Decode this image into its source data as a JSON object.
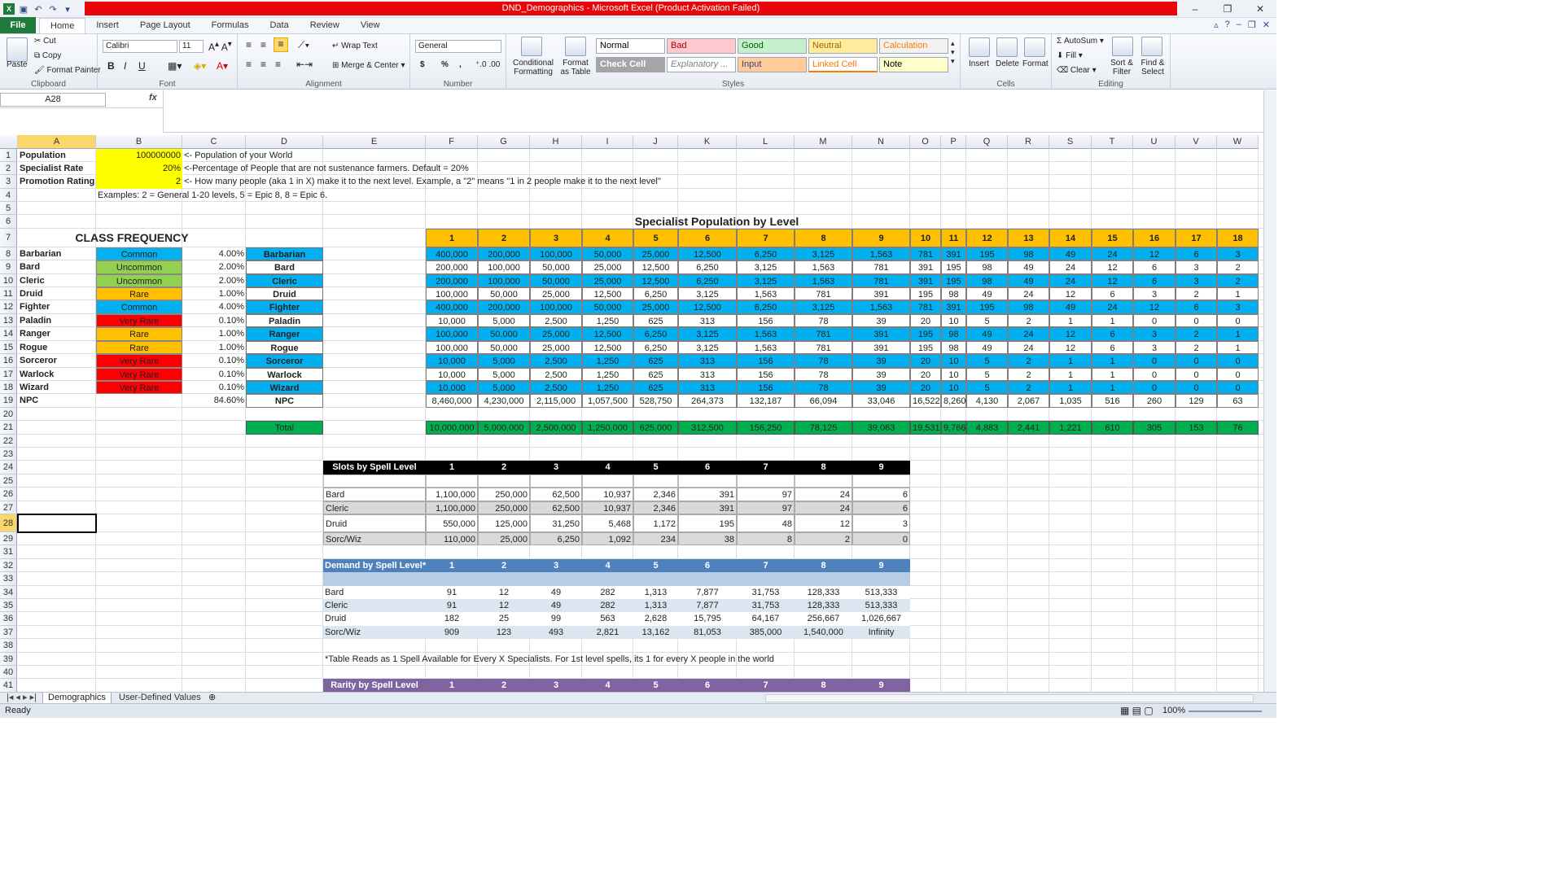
{
  "window": {
    "title": "DND_Demographics - Microsoft Excel (Product Activation Failed)",
    "min": "–",
    "restore": "❐",
    "close": "✕"
  },
  "menu": {
    "file": "File",
    "tabs": [
      "Home",
      "Insert",
      "Page Layout",
      "Formulas",
      "Data",
      "Review",
      "View"
    ]
  },
  "ribbon": {
    "clipboard": {
      "paste": "Paste",
      "cut": "Cut",
      "copy": "Copy",
      "painter": "Format Painter",
      "label": "Clipboard"
    },
    "font": {
      "name": "Calibri",
      "size": "11",
      "label": "Font",
      "bold": "B",
      "italic": "I",
      "underline": "U"
    },
    "alignment": {
      "wrap": "Wrap Text",
      "merge": "Merge & Center",
      "label": "Alignment"
    },
    "number": {
      "format": "General",
      "dollar": "$",
      "percent": "%",
      "comma": ",",
      "label": "Number"
    },
    "styles": {
      "cond": [
        "Conditional",
        "Formatting"
      ],
      "table": [
        "Format",
        "as Table"
      ],
      "label": "Styles",
      "boxes": [
        {
          "t": "Normal",
          "bg": "#ffffff",
          "fg": "#000000"
        },
        {
          "t": "Bad",
          "bg": "#ffc7ce",
          "fg": "#9c0006"
        },
        {
          "t": "Good",
          "bg": "#c6efce",
          "fg": "#006100"
        },
        {
          "t": "Neutral",
          "bg": "#ffeb9c",
          "fg": "#9c6500"
        },
        {
          "t": "Calculation",
          "bg": "#f2f2f2",
          "fg": "#fa7d00"
        },
        {
          "t": "Check Cell",
          "bg": "#a5a5a5",
          "fg": "#ffffff"
        },
        {
          "t": "Explanatory ...",
          "bg": "#ffffff",
          "fg": "#7f7f7f"
        },
        {
          "t": "Input",
          "bg": "#ffcc99",
          "fg": "#3f3f76"
        },
        {
          "t": "Linked Cell",
          "bg": "#ffffff",
          "fg": "#fa7d00"
        },
        {
          "t": "Note",
          "bg": "#ffffcc",
          "fg": "#000000"
        }
      ]
    },
    "cells": {
      "insert": "Insert",
      "delete": "Delete",
      "format": "Format",
      "label": "Cells"
    },
    "editing": {
      "autosum": "AutoSum",
      "fill": "Fill",
      "clear": "Clear",
      "sort": [
        "Sort &",
        "Filter"
      ],
      "find": [
        "Find &",
        "Select"
      ],
      "label": "Editing"
    }
  },
  "formula_bar": {
    "name_box": "A28",
    "fx": "fx",
    "content": ""
  },
  "columns": [
    {
      "l": "A",
      "w": 96
    },
    {
      "l": "B",
      "w": 106
    },
    {
      "l": "C",
      "w": 78
    },
    {
      "l": "D",
      "w": 95
    },
    {
      "l": "E",
      "w": 126
    },
    {
      "l": "F",
      "w": 64
    },
    {
      "l": "G",
      "w": 64
    },
    {
      "l": "H",
      "w": 64
    },
    {
      "l": "I",
      "w": 63
    },
    {
      "l": "J",
      "w": 55
    },
    {
      "l": "K",
      "w": 72
    },
    {
      "l": "L",
      "w": 71
    },
    {
      "l": "M",
      "w": 71
    },
    {
      "l": "N",
      "w": 71
    },
    {
      "l": "O",
      "w": 38
    },
    {
      "l": "P",
      "w": 31
    },
    {
      "l": "Q",
      "w": 51
    },
    {
      "l": "R",
      "w": 51
    },
    {
      "l": "S",
      "w": 52
    },
    {
      "l": "T",
      "w": 51
    },
    {
      "l": "U",
      "w": 52
    },
    {
      "l": "V",
      "w": 51
    },
    {
      "l": "W",
      "w": 51
    }
  ],
  "rows": [
    {
      "n": "1",
      "h": 16
    },
    {
      "n": "2",
      "h": 16
    },
    {
      "n": "3",
      "h": 17
    },
    {
      "n": "4",
      "h": 16
    },
    {
      "n": "5",
      "h": 16
    },
    {
      "n": "6",
      "h": 17
    },
    {
      "n": "7",
      "h": 23
    },
    {
      "n": "8",
      "h": 16
    },
    {
      "n": "9",
      "h": 17
    },
    {
      "n": "10",
      "h": 16
    },
    {
      "n": "11",
      "h": 16
    },
    {
      "n": "12",
      "h": 17
    },
    {
      "n": "13",
      "h": 16
    },
    {
      "n": "14",
      "h": 17
    },
    {
      "n": "15",
      "h": 16
    },
    {
      "n": "16",
      "h": 17
    },
    {
      "n": "17",
      "h": 16
    },
    {
      "n": "18",
      "h": 16
    },
    {
      "n": "19",
      "h": 17
    },
    {
      "n": "20",
      "h": 16
    },
    {
      "n": "21",
      "h": 17
    },
    {
      "n": "22",
      "h": 16
    },
    {
      "n": "23",
      "h": 16
    },
    {
      "n": "24",
      "h": 17
    },
    {
      "n": "25",
      "h": 16
    },
    {
      "n": "26",
      "h": 17
    },
    {
      "n": "27",
      "h": 16
    },
    {
      "n": "28",
      "h": 22
    },
    {
      "n": "29",
      "h": 16
    },
    {
      "n": "31",
      "h": 17
    },
    {
      "n": "32",
      "h": 16
    },
    {
      "n": "33",
      "h": 17
    },
    {
      "n": "34",
      "h": 16
    },
    {
      "n": "35",
      "h": 16
    },
    {
      "n": "36",
      "h": 17
    },
    {
      "n": "37",
      "h": 16
    },
    {
      "n": "38",
      "h": 17
    },
    {
      "n": "39",
      "h": 16
    },
    {
      "n": "40",
      "h": 16
    },
    {
      "n": "41",
      "h": 17
    }
  ],
  "top_cells": [
    {
      "r": "1",
      "c": "A",
      "t": "Population",
      "b": 1
    },
    {
      "r": "1",
      "c": "B",
      "t": "100000000",
      "bg": "#ffff00",
      "al": "r"
    },
    {
      "r": "1",
      "c": "C",
      "t": "<- Population of your World",
      "sp": 5
    },
    {
      "r": "2",
      "c": "A",
      "t": "Specialist Rate",
      "b": 1
    },
    {
      "r": "2",
      "c": "B",
      "t": "20%",
      "bg": "#ffff00",
      "al": "r"
    },
    {
      "r": "2",
      "c": "C",
      "t": "<-Percentage of People that are not sustenance farmers. Default = 20%",
      "sp": 6
    },
    {
      "r": "3",
      "c": "A",
      "t": "Promotion Rating",
      "b": 1
    },
    {
      "r": "3",
      "c": "B",
      "t": "2",
      "bg": "#ffff00",
      "al": "r"
    },
    {
      "r": "3",
      "c": "C",
      "t": "<- How many people (aka 1 in X) make it to the next level. Example, a \"2\" means \"1 in 2 people make it to the next level\"",
      "sp": 12
    },
    {
      "r": "4",
      "c": "B",
      "t": "Examples: 2 = General 1-20 levels, 5 = Epic 8, 8 = Epic 6.",
      "sp": 6
    },
    {
      "r": "6",
      "c": "F",
      "t": "Specialist Population by Level",
      "b": 1,
      "sp": 12,
      "al": "c",
      "fs": 14
    },
    {
      "r": "7",
      "c": "A",
      "t": "CLASS FREQUENCY",
      "b": 1,
      "sp": 3,
      "al": "c",
      "fs": 14
    }
  ],
  "class_rows": [
    {
      "r": "8",
      "name": "Barbarian",
      "rarity": "Common",
      "rbg": "#00b0f0",
      "pct": "4.00%",
      "dbg": "#00b0f0"
    },
    {
      "r": "9",
      "name": "Bard",
      "rarity": "Uncommon",
      "rbg": "#92d050",
      "pct": "2.00%",
      "dbg": "#ffffff"
    },
    {
      "r": "10",
      "name": "Cleric",
      "rarity": "Uncommon",
      "rbg": "#92d050",
      "pct": "2.00%",
      "dbg": "#00b0f0"
    },
    {
      "r": "11",
      "name": "Druid",
      "rarity": "Rare",
      "rbg": "#ffc000",
      "pct": "1.00%",
      "dbg": "#ffffff"
    },
    {
      "r": "12",
      "name": "Fighter",
      "rarity": "Common",
      "rbg": "#00b0f0",
      "pct": "4.00%",
      "dbg": "#00b0f0"
    },
    {
      "r": "13",
      "name": "Paladin",
      "rarity": "Very Rare",
      "rbg": "#ff0000",
      "pct": "0.10%",
      "dbg": "#ffffff"
    },
    {
      "r": "14",
      "name": "Ranger",
      "rarity": "Rare",
      "rbg": "#ffc000",
      "pct": "1.00%",
      "dbg": "#00b0f0"
    },
    {
      "r": "15",
      "name": "Rogue",
      "rarity": "Rare",
      "rbg": "#ffc000",
      "pct": "1.00%",
      "dbg": "#ffffff"
    },
    {
      "r": "16",
      "name": "Sorceror",
      "rarity": "Very Rare",
      "rbg": "#ff0000",
      "pct": "0.10%",
      "dbg": "#00b0f0"
    },
    {
      "r": "17",
      "name": "Warlock",
      "rarity": "Very Rare",
      "rbg": "#ff0000",
      "pct": "0.10%",
      "dbg": "#ffffff"
    },
    {
      "r": "18",
      "name": "Wizard",
      "rarity": "Very Rare",
      "rbg": "#ff0000",
      "pct": "0.10%",
      "dbg": "#00b0f0"
    },
    {
      "r": "19",
      "name": "NPC",
      "rarity": "",
      "rbg": "",
      "pct": "84.60%",
      "dbg": "#ffffff"
    }
  ],
  "level_header": [
    "1",
    "2",
    "3",
    "4",
    "5",
    "6",
    "7",
    "8",
    "9",
    "10",
    "11",
    "12",
    "13",
    "14",
    "15",
    "16",
    "17",
    "18"
  ],
  "level_rows": [
    {
      "r": "8",
      "v": [
        "400,000",
        "200,000",
        "100,000",
        "50,000",
        "25,000",
        "12,500",
        "6,250",
        "3,125",
        "1,563",
        "781",
        "391",
        "195",
        "98",
        "49",
        "24",
        "12",
        "6",
        "3"
      ]
    },
    {
      "r": "9",
      "v": [
        "200,000",
        "100,000",
        "50,000",
        "25,000",
        "12,500",
        "6,250",
        "3,125",
        "1,563",
        "781",
        "391",
        "195",
        "98",
        "49",
        "24",
        "12",
        "6",
        "3",
        "2"
      ]
    },
    {
      "r": "10",
      "v": [
        "200,000",
        "100,000",
        "50,000",
        "25,000",
        "12,500",
        "6,250",
        "3,125",
        "1,563",
        "781",
        "391",
        "195",
        "98",
        "49",
        "24",
        "12",
        "6",
        "3",
        "2"
      ]
    },
    {
      "r": "11",
      "v": [
        "100,000",
        "50,000",
        "25,000",
        "12,500",
        "6,250",
        "3,125",
        "1,563",
        "781",
        "391",
        "195",
        "98",
        "49",
        "24",
        "12",
        "6",
        "3",
        "2",
        "1"
      ]
    },
    {
      "r": "12",
      "v": [
        "400,000",
        "200,000",
        "100,000",
        "50,000",
        "25,000",
        "12,500",
        "6,250",
        "3,125",
        "1,563",
        "781",
        "391",
        "195",
        "98",
        "49",
        "24",
        "12",
        "6",
        "3"
      ]
    },
    {
      "r": "13",
      "v": [
        "10,000",
        "5,000",
        "2,500",
        "1,250",
        "625",
        "313",
        "156",
        "78",
        "39",
        "20",
        "10",
        "5",
        "2",
        "1",
        "1",
        "0",
        "0",
        "0"
      ]
    },
    {
      "r": "14",
      "v": [
        "100,000",
        "50,000",
        "25,000",
        "12,500",
        "6,250",
        "3,125",
        "1,563",
        "781",
        "391",
        "195",
        "98",
        "49",
        "24",
        "12",
        "6",
        "3",
        "2",
        "1"
      ]
    },
    {
      "r": "15",
      "v": [
        "100,000",
        "50,000",
        "25,000",
        "12,500",
        "6,250",
        "3,125",
        "1,563",
        "781",
        "391",
        "195",
        "98",
        "49",
        "24",
        "12",
        "6",
        "3",
        "2",
        "1"
      ]
    },
    {
      "r": "16",
      "v": [
        "10,000",
        "5,000",
        "2,500",
        "1,250",
        "625",
        "313",
        "156",
        "78",
        "39",
        "20",
        "10",
        "5",
        "2",
        "1",
        "1",
        "0",
        "0",
        "0"
      ]
    },
    {
      "r": "17",
      "v": [
        "10,000",
        "5,000",
        "2,500",
        "1,250",
        "625",
        "313",
        "156",
        "78",
        "39",
        "20",
        "10",
        "5",
        "2",
        "1",
        "1",
        "0",
        "0",
        "0"
      ]
    },
    {
      "r": "18",
      "v": [
        "10,000",
        "5,000",
        "2,500",
        "1,250",
        "625",
        "313",
        "156",
        "78",
        "39",
        "20",
        "10",
        "5",
        "2",
        "1",
        "1",
        "0",
        "0",
        "0"
      ]
    },
    {
      "r": "19",
      "v": [
        "8,460,000",
        "4,230,000",
        "2,115,000",
        "1,057,500",
        "528,750",
        "264,373",
        "132,187",
        "66,094",
        "33,046",
        "16,522",
        "8,260",
        "4,130",
        "2,067",
        "1,035",
        "516",
        "260",
        "129",
        "63"
      ]
    }
  ],
  "total": {
    "label": "Total",
    "v": [
      "10,000,000",
      "5,000,000",
      "2,500,000",
      "1,250,000",
      "625,000",
      "312,500",
      "156,250",
      "78,125",
      "39,063",
      "19,531",
      "9,766",
      "4,883",
      "2,441",
      "1,221",
      "610",
      "305",
      "153",
      "76"
    ]
  },
  "slots": {
    "title": "Slots by Spell Level",
    "header": [
      "1",
      "2",
      "3",
      "4",
      "5",
      "6",
      "7",
      "8",
      "9"
    ],
    "rows": [
      {
        "r": "26",
        "name": "Bard",
        "v": [
          "1,100,000",
          "250,000",
          "62,500",
          "10,937",
          "2,346",
          "391",
          "97",
          "24",
          "6"
        ]
      },
      {
        "r": "27",
        "name": "Cleric",
        "v": [
          "1,100,000",
          "250,000",
          "62,500",
          "10,937",
          "2,346",
          "391",
          "97",
          "24",
          "6"
        ]
      },
      {
        "r": "28",
        "name": "Druid",
        "v": [
          "550,000",
          "125,000",
          "31,250",
          "5,468",
          "1,172",
          "195",
          "48",
          "12",
          "3"
        ]
      },
      {
        "r": "29",
        "name": "Sorc/Wiz",
        "v": [
          "110,000",
          "25,000",
          "6,250",
          "1,092",
          "234",
          "38",
          "8",
          "2",
          "0"
        ]
      }
    ]
  },
  "demand": {
    "title": "Demand by Spell Level*",
    "header": [
      "1",
      "2",
      "3",
      "4",
      "5",
      "6",
      "7",
      "8",
      "9"
    ],
    "rows": [
      {
        "r": "34",
        "name": "Bard",
        "v": [
          "91",
          "12",
          "49",
          "282",
          "1,313",
          "7,877",
          "31,753",
          "128,333",
          "513,333"
        ]
      },
      {
        "r": "35",
        "name": "Cleric",
        "v": [
          "91",
          "12",
          "49",
          "282",
          "1,313",
          "7,877",
          "31,753",
          "128,333",
          "513,333"
        ]
      },
      {
        "r": "36",
        "name": "Druid",
        "v": [
          "182",
          "25",
          "99",
          "563",
          "2,628",
          "15,795",
          "64,167",
          "256,667",
          "1,026,667"
        ]
      },
      {
        "r": "37",
        "name": "Sorc/Wiz",
        "v": [
          "909",
          "123",
          "493",
          "2,821",
          "13,162",
          "81,053",
          "385,000",
          "1,540,000",
          "Infinity"
        ]
      }
    ]
  },
  "note": "*Table Reads as 1 Spell Available for Every X Specialists. For 1st level spells, its 1 for every X people in the world",
  "rarity": {
    "title": "Rarity by Spell Level",
    "header": [
      "1",
      "2",
      "3",
      "4",
      "5",
      "6",
      "7",
      "8",
      "9"
    ]
  },
  "sheets": [
    "Demographics",
    "User-Defined Values"
  ],
  "status": {
    "ready": "Ready",
    "zoom": "100%"
  }
}
